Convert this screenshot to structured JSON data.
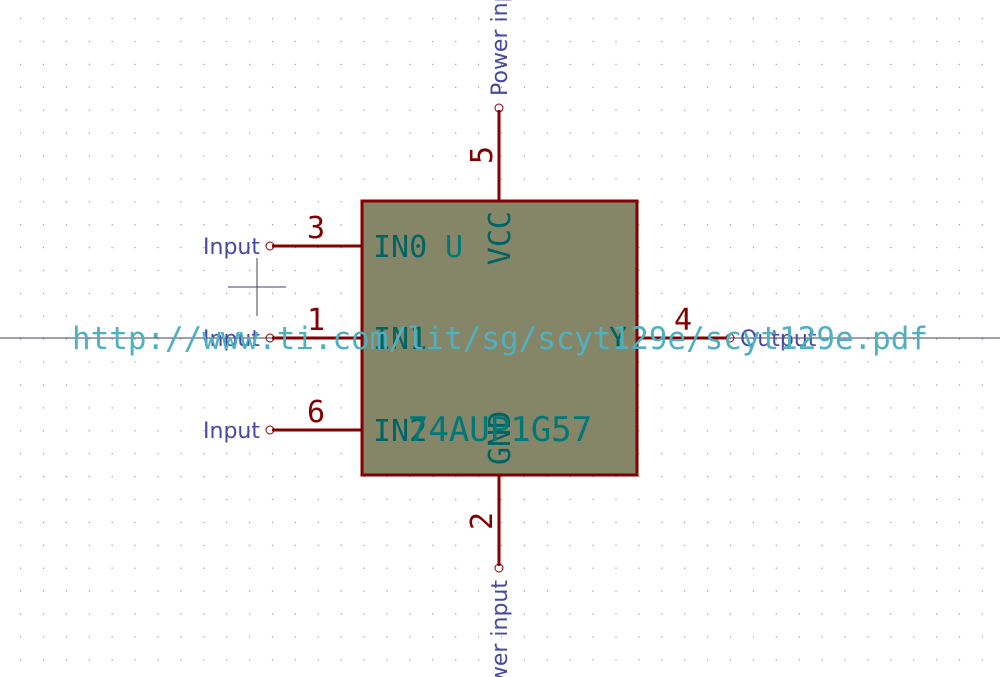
{
  "symbol": {
    "reference": "U",
    "value": "74AUP1G57",
    "datasheet": "http://www.ti.com/lit/sg/scyt129e/scyt129e.pdf",
    "body_fill": "#858568",
    "outline_color": "#840000"
  },
  "pins": [
    {
      "number": "3",
      "name": "IN0",
      "type": "Input"
    },
    {
      "number": "1",
      "name": "IN1",
      "type": "Input"
    },
    {
      "number": "6",
      "name": "IN2",
      "type": "Input"
    },
    {
      "number": "4",
      "name": "Y",
      "type": "Output"
    },
    {
      "number": "5",
      "name": "VCC",
      "type": "Power input"
    },
    {
      "number": "2",
      "name": "GND",
      "type": "Power input"
    }
  ],
  "colors": {
    "pin_line": "#840000",
    "pin_number": "#840000",
    "pin_name": "#006464",
    "pin_type": "#4848a0",
    "reference_text": "#007878",
    "datasheet_text": "#4fb0c0",
    "crosshair": "#404060",
    "grid_dot": "#9a9a9a"
  }
}
